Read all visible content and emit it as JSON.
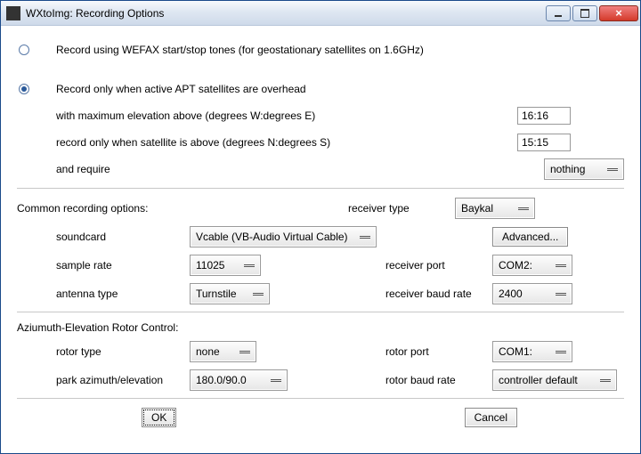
{
  "title": "WXtoImg: Recording Options",
  "option_wefax": "Record using WEFAX start/stop tones (for geostationary satellites on 1.6GHz)",
  "option_apt": "Record only when active APT satellites are overhead",
  "apt": {
    "elev_label": "with maximum elevation above (degrees W:degrees E)",
    "elev_value": "16:16",
    "above_label": "record only when satellite is above (degrees N:degrees S)",
    "above_value": "15:15",
    "require_label": "and require",
    "require_value": "nothing"
  },
  "common": {
    "heading": "Common recording options:",
    "soundcard_label": "soundcard",
    "soundcard_value": "Vcable (VB-Audio Virtual Cable)",
    "samplerate_label": "sample rate",
    "samplerate_value": "11025",
    "antenna_label": "antenna type",
    "antenna_value": "Turnstile",
    "recvtype_label": "receiver type",
    "recvtype_value": "Baykal",
    "advanced": "Advanced...",
    "recvport_label": "receiver port",
    "recvport_value": "COM2:",
    "recvbaud_label": "receiver baud rate",
    "recvbaud_value": "2400"
  },
  "rotor": {
    "heading": "Aziumuth-Elevation Rotor Control:",
    "type_label": "rotor type",
    "type_value": "none",
    "park_label": "park azimuth/elevation",
    "park_value": "180.0/90.0",
    "port_label": "rotor port",
    "port_value": "COM1:",
    "baud_label": "rotor baud rate",
    "baud_value": "controller default"
  },
  "buttons": {
    "ok": "OK",
    "cancel": "Cancel"
  }
}
